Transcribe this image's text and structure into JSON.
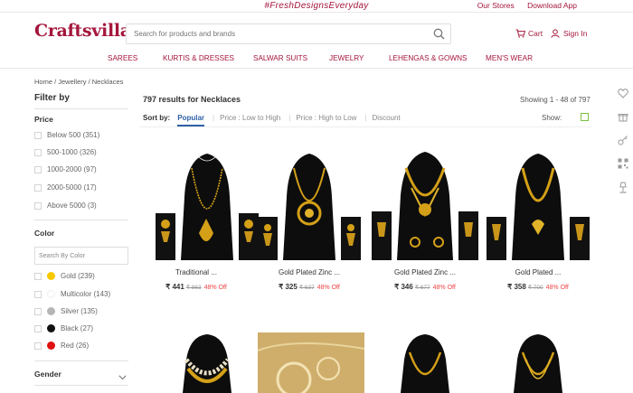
{
  "topbar": {
    "hashtag": "#FreshDesignsEveryday",
    "our_stores": "Our Stores",
    "download_app": "Download App"
  },
  "header": {
    "logo": "Craftsvilla",
    "search_placeholder": "Search for products and brands",
    "cart": "Cart",
    "signin": "Sign In"
  },
  "nav": [
    "SAREES",
    "KURTIS & DRESSES",
    "SALWAR SUITS",
    "JEWELRY",
    "LEHENGAS & GOWNS",
    "MEN'S WEAR"
  ],
  "breadcrumb": "Home / Jewellery / Necklaces",
  "filter": {
    "title": "Filter by",
    "price_label": "Price",
    "price_options": [
      "Below 500 (351)",
      "500-1000 (326)",
      "1000-2000 (97)",
      "2000-5000 (17)",
      "Above 5000 (3)"
    ],
    "color_label": "Color",
    "color_search_placeholder": "Search By Color",
    "color_options": [
      {
        "label": "Gold (239)",
        "color": "#f5c800"
      },
      {
        "label": "Multicolor (143)",
        "color": "#ffffff"
      },
      {
        "label": "Silver (135)",
        "color": "#b5b5b5"
      },
      {
        "label": "Black (27)",
        "color": "#111111"
      },
      {
        "label": "Red (26)",
        "color": "#e01010"
      }
    ],
    "gender_label": "Gender"
  },
  "results": {
    "count_text": "797 results for  Necklaces",
    "showing_text": "Showing   1 - 48 of 797",
    "sort_label": "Sort by:",
    "sort_options": [
      "Popular",
      "Price : Low to High",
      "Price : High to Low",
      "Discount"
    ],
    "show_label": "Show:"
  },
  "products": [
    {
      "name": "Traditional ...",
      "price": "₹ 441",
      "mrp": "₹ 863",
      "discount": "48% Off"
    },
    {
      "name": "Gold Plated Zinc ...",
      "price": "₹ 325",
      "mrp": "₹ 637",
      "discount": "48% Off"
    },
    {
      "name": "Gold Plated Zinc ...",
      "price": "₹ 346",
      "mrp": "₹ 677",
      "discount": "48% Off"
    },
    {
      "name": "Gold Plated ...",
      "price": "₹ 358",
      "mrp": "₹ 700",
      "discount": "48% Off"
    }
  ],
  "icons": [
    "heart-icon",
    "gift-icon",
    "key-icon",
    "qr-code-icon",
    "desk-lamp-icon"
  ],
  "colors": {
    "brand": "#a4163c",
    "link_active": "#2f5fa6",
    "discount": "#e44444"
  }
}
